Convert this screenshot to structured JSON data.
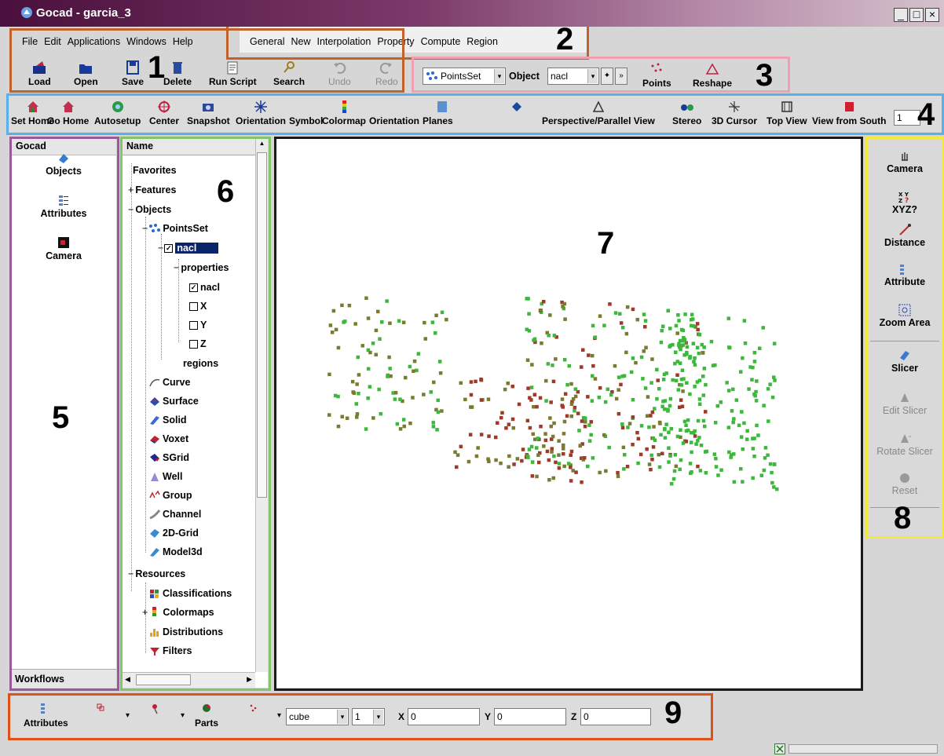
{
  "window": {
    "title": "Gocad - garcia_3"
  },
  "menus_main": [
    "File",
    "Edit",
    "Applications",
    "Windows",
    "Help"
  ],
  "menus_context": [
    "General",
    "New",
    "Interpolation",
    "Property",
    "Compute",
    "Region"
  ],
  "toolbar_main": [
    {
      "label": "Load",
      "enabled": true
    },
    {
      "label": "Open",
      "enabled": true
    },
    {
      "label": "Save",
      "enabled": true
    },
    {
      "label": "Delete",
      "enabled": true
    },
    {
      "label": "Run Script",
      "enabled": true
    },
    {
      "label": "Search",
      "enabled": true
    },
    {
      "label": "Undo",
      "enabled": false
    },
    {
      "label": "Redo",
      "enabled": false
    }
  ],
  "object_selector": {
    "type_value": "PointsSet",
    "object_label": "Object",
    "object_value": "nacl"
  },
  "toolbar_object": [
    "Points",
    "Reshape"
  ],
  "toolbar_view": [
    "Set Home",
    "Go Home",
    "Autosetup",
    "Center",
    "Snapshot",
    "Orientation",
    "Symbol",
    "Colormap",
    "Orientation",
    "Planes",
    "Perspective/Parallel View",
    "Stereo",
    "3D Cursor",
    "Top View",
    "View from South"
  ],
  "view_spin_value": "1",
  "left_panel": {
    "header": "Gocad",
    "items": [
      "Objects",
      "Attributes",
      "Camera"
    ],
    "footer": "Workflows"
  },
  "tree": {
    "header": "Name",
    "nodes": {
      "favorites": "Favorites",
      "features": "Features",
      "objects": "Objects",
      "pointsset": "PointsSet",
      "nacl": "nacl",
      "properties": "properties",
      "prop_nacl": "nacl",
      "prop_x": "X",
      "prop_y": "Y",
      "prop_z": "Z",
      "regions": "regions",
      "curve": "Curve",
      "surface": "Surface",
      "solid": "Solid",
      "voxet": "Voxet",
      "sgrid": "SGrid",
      "well": "Well",
      "group": "Group",
      "channel": "Channel",
      "grid2d": "2D-Grid",
      "model3d": "Model3d",
      "resources": "Resources",
      "classifications": "Classifications",
      "colormaps": "Colormaps",
      "distributions": "Distributions",
      "filters": "Filters"
    }
  },
  "right_panel": [
    {
      "label": "Camera",
      "enabled": true
    },
    {
      "label": "XYZ?",
      "enabled": true
    },
    {
      "label": "Distance",
      "enabled": true
    },
    {
      "label": "Attribute",
      "enabled": true
    },
    {
      "label": "Zoom Area",
      "enabled": true
    },
    {
      "label": "Slicer",
      "enabled": true
    },
    {
      "label": "Edit Slicer",
      "enabled": false
    },
    {
      "label": "Rotate Slicer",
      "enabled": false
    },
    {
      "label": "Reset",
      "enabled": false
    }
  ],
  "bottom_toolbar": {
    "attributes_label": "Attributes",
    "parts_label": "Parts",
    "shape_value": "cube",
    "size_value": "1",
    "x_label": "X",
    "x_value": "0",
    "y_label": "Y",
    "y_value": "0",
    "z_label": "Z",
    "z_value": "0"
  },
  "annotations": [
    "1",
    "2",
    "3",
    "4",
    "5",
    "6",
    "7",
    "8",
    "9"
  ],
  "colors": {
    "frame1": "#c0622a",
    "frame2": "#c0622a",
    "frame3": "#f0a0b0",
    "frame4": "#5ab0e8",
    "frame5": "#9a5a9a",
    "frame6": "#86c46a",
    "frame7": "#1a1a1a",
    "frame8": "#f2ea3a",
    "frame9": "#e0501a",
    "point_red": "#a03a28",
    "point_green": "#3cb83c",
    "point_olive": "#7a7a30"
  }
}
